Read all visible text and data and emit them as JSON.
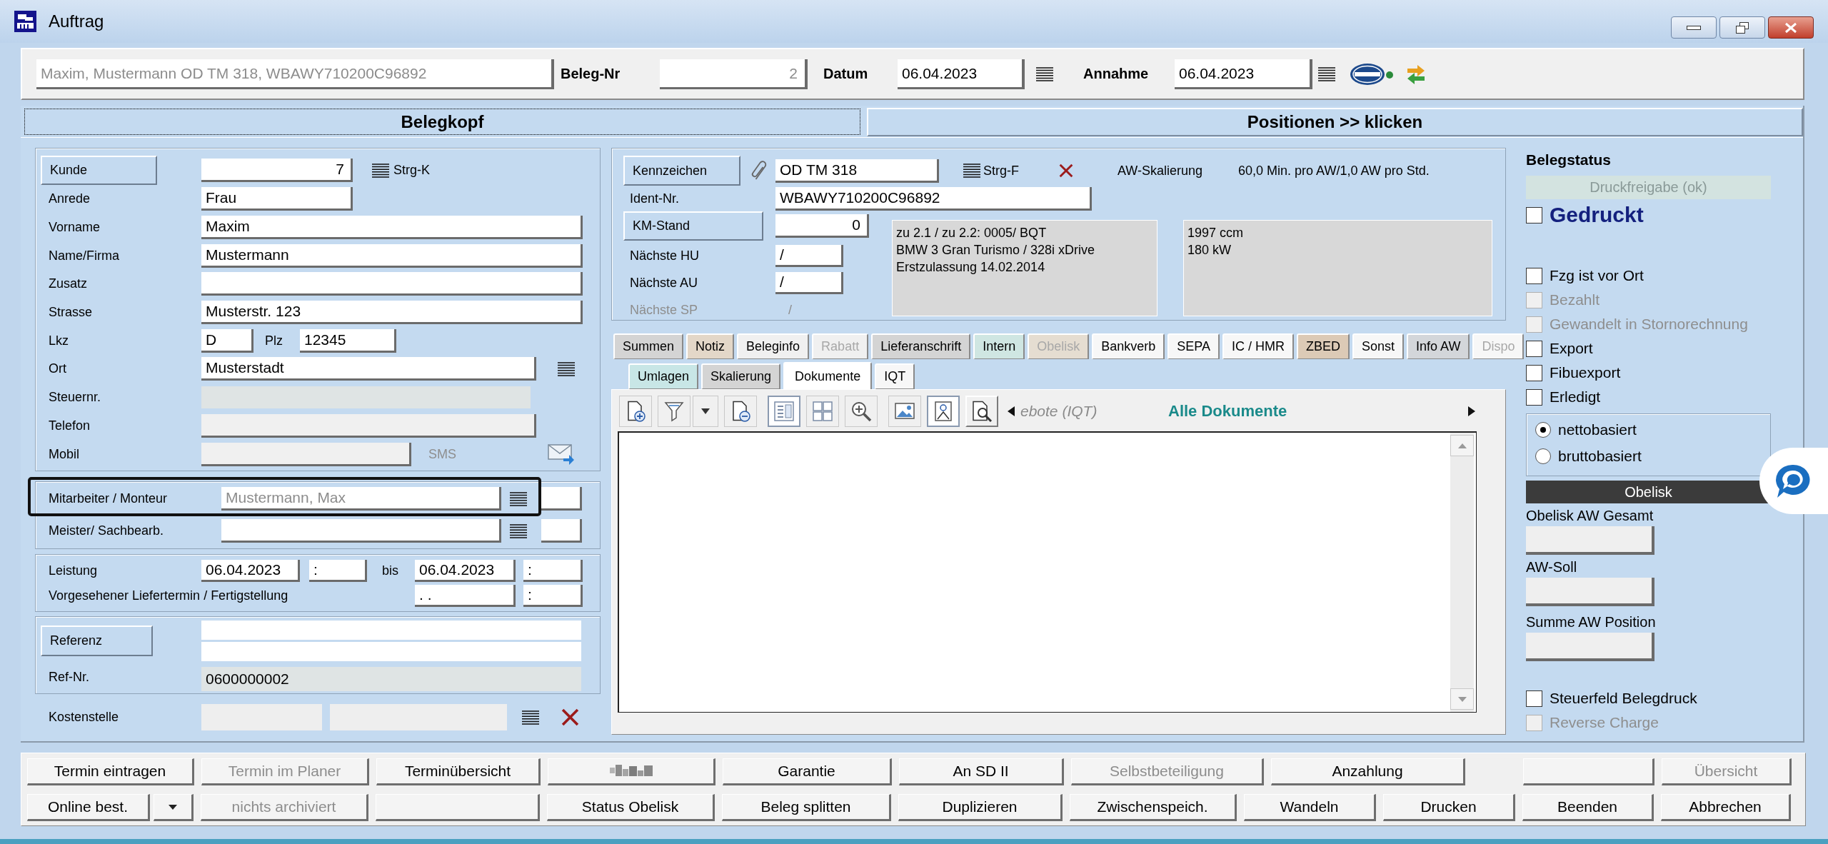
{
  "window": {
    "title": "Auftrag"
  },
  "header": {
    "summary": "Maxim, Mustermann OD TM 318, WBAWY710200C96892",
    "fields": [
      {
        "label": "Beleg-Nr",
        "value": "2",
        "kind": "number"
      },
      {
        "label": "Datum",
        "value": "06.04.2023",
        "kind": "date"
      },
      {
        "label": "Annahme",
        "value": "06.04.2023",
        "kind": "date"
      }
    ]
  },
  "page_tabs": [
    {
      "label": "Belegkopf",
      "selected": true
    },
    {
      "label": "Positionen >> klicken",
      "selected": false
    }
  ],
  "customer": {
    "rows": [
      {
        "label": "Kunde",
        "value": "7",
        "kind": "lookup",
        "hint": "Strg-K",
        "disabled": false
      },
      {
        "label": "Anrede",
        "value": "Frau",
        "kind": "short",
        "disabled": false
      },
      {
        "label": "Vorname",
        "value": "Maxim",
        "kind": "text",
        "disabled": false
      },
      {
        "label": "Name/Firma",
        "value": "Mustermann",
        "kind": "text",
        "disabled": false
      },
      {
        "label": "Zusatz",
        "kind": "text",
        "disabled": false
      },
      {
        "label": "Strasse",
        "value": "Musterstr. 123",
        "kind": "text",
        "disabled": false
      },
      {
        "label": "Lkz",
        "value": "D",
        "kind": "postal",
        "second_label": "Plz",
        "second_value": "12345",
        "disabled": false
      },
      {
        "label": "Ort",
        "value": "Musterstadt",
        "kind": "list",
        "disabled": false
      },
      {
        "label": "Steuernr.",
        "kind": "flat",
        "disabled": true
      },
      {
        "label": "Telefon",
        "kind": "wide",
        "disabled": true
      },
      {
        "label": "Mobil",
        "kind": "mobile",
        "hint": "SMS",
        "disabled": true
      }
    ]
  },
  "staff": {
    "rows": [
      {
        "label": "Mitarbeiter / Monteur",
        "value": "Mustermann, Max",
        "highlighted": true
      },
      {
        "label": "Meister/ Sachbearb.",
        "highlighted": false
      }
    ]
  },
  "service": {
    "rows": [
      {
        "label": "Leistung",
        "from_date": "06.04.2023",
        "from_time": ":",
        "to_label": "bis",
        "to_date": "06.04.2023",
        "to_time": ":"
      },
      {
        "label": "Vorgesehener Liefertermin / Fertigstellung",
        "to_date": ". .",
        "to_time": ":"
      }
    ]
  },
  "reference": {
    "button": "Referenz",
    "ref_label": "Ref-Nr.",
    "ref_value": "0600000002"
  },
  "cost_center": {
    "label": "Kostenstelle"
  },
  "vehicle": {
    "plate": {
      "label": "Kennzeichen",
      "value": "OD TM 318",
      "hint": "Strg-F"
    },
    "scaling": {
      "label": "AW-Skalierung",
      "value": "60,0 Min. pro AW/1,0 AW pro Std."
    },
    "ident": {
      "label": "Ident-Nr.",
      "value": "WBAWY710200C96892"
    },
    "rows": [
      {
        "label": "KM-Stand",
        "value": "0",
        "kind": "button",
        "disabled": false
      },
      {
        "label": "Nächste HU",
        "value": "/",
        "kind": "field",
        "disabled": false
      },
      {
        "label": "Nächste AU",
        "value": "/",
        "kind": "field",
        "disabled": false
      },
      {
        "label": "Nächste SP",
        "value": "/",
        "kind": "plain",
        "disabled": true
      }
    ],
    "info": [
      {
        "lines": [
          "zu 2.1 / zu 2.2: 0005/ BQT",
          "BMW 3 Gran Turismo / 328i xDrive",
          "Erstzulassung 14.02.2014"
        ]
      },
      {
        "lines": [
          "1997 ccm",
          "180 kW"
        ]
      }
    ]
  },
  "detail_tab_rows": [
    {
      "tabs": [
        {
          "label": "Summen",
          "color": "#d4d4d4",
          "disabled": false,
          "selected": false
        },
        {
          "label": "Notiz",
          "color": "#e3d7c8",
          "disabled": false,
          "selected": false
        },
        {
          "label": "Beleginfo",
          "color": "#f0f0f0",
          "disabled": false,
          "selected": false
        },
        {
          "label": "Rabatt",
          "color": "#f0f0f0",
          "disabled": true,
          "selected": false
        },
        {
          "label": "Lieferanschrift",
          "color": "#d4d4d4",
          "disabled": false,
          "selected": false
        },
        {
          "label": "Intern",
          "color": "#cfe6e2",
          "disabled": false,
          "selected": false
        },
        {
          "label": "Obelisk",
          "color": "#e5ddd1",
          "disabled": true,
          "selected": false
        },
        {
          "label": "Bankverb",
          "color": "#f7f7f7",
          "disabled": false,
          "selected": false
        },
        {
          "label": "SEPA",
          "color": "#f7f7f7",
          "disabled": false,
          "selected": false
        },
        {
          "label": "IC / HMR",
          "color": "#f7f7f7",
          "disabled": false,
          "selected": false
        },
        {
          "label": "ZBED",
          "color": "#dccab6",
          "disabled": false,
          "selected": false
        },
        {
          "label": "Sonst",
          "color": "#f7f7f7",
          "disabled": false,
          "selected": false
        },
        {
          "label": "Info AW",
          "color": "#d3d6da",
          "disabled": false,
          "selected": false
        },
        {
          "label": "Dispo",
          "color": "#f7f7f7",
          "disabled": true,
          "selected": false
        }
      ]
    },
    {
      "tabs": [
        {
          "label": "Umlagen",
          "color": "#c8e6e6",
          "disabled": false,
          "selected": false
        },
        {
          "label": "Skalierung",
          "color": "#d4d4d4",
          "disabled": false,
          "selected": false
        },
        {
          "label": "Dokumente",
          "color": "#ffffff",
          "disabled": false,
          "selected": true
        },
        {
          "label": "IQT",
          "color": "#f7f7f7",
          "disabled": false,
          "selected": false
        }
      ]
    }
  ],
  "documents": {
    "tools": [
      {
        "kind": "attach",
        "pressed": false
      },
      {
        "kind": "filter",
        "pressed": false
      },
      {
        "kind": "caret",
        "pressed": false
      },
      {
        "kind": "detach",
        "pressed": false
      },
      {
        "kind": "list",
        "pressed": true
      },
      {
        "kind": "grid",
        "pressed": false
      },
      {
        "kind": "zoom",
        "pressed": false
      },
      {
        "kind": "image",
        "pressed": false
      },
      {
        "kind": "portrait",
        "pressed": true
      },
      {
        "kind": "preview",
        "pressed": false
      }
    ],
    "caption": "ebote (IQT)",
    "title": "Alle Dokumente"
  },
  "status": {
    "title": "Belegstatus",
    "release": "Druckfreigabe (ok)",
    "printed": {
      "label": "Gedruckt",
      "checked": false
    },
    "checks": [
      {
        "label": "Fzg ist vor Ort",
        "checked": false,
        "disabled": false
      },
      {
        "label": "Bezahlt",
        "checked": false,
        "disabled": true
      },
      {
        "label": "Gewandelt in Stornorechnung",
        "checked": false,
        "disabled": true
      },
      {
        "label": "Export",
        "checked": false,
        "disabled": false
      },
      {
        "label": "Fibuexport",
        "checked": false,
        "disabled": false
      },
      {
        "label": "Erledigt",
        "checked": false,
        "disabled": false
      }
    ],
    "basis": [
      {
        "label": "nettobasiert",
        "selected": true
      },
      {
        "label": "bruttobasiert",
        "selected": false
      }
    ],
    "obelisk": {
      "title": "Obelisk",
      "fields": [
        {
          "label": "Obelisk AW Gesamt"
        },
        {
          "label": "AW-Soll"
        },
        {
          "label": "Summe AW Position"
        }
      ]
    },
    "options": [
      {
        "label": "Steuerfeld Belegdruck",
        "checked": false,
        "disabled": false
      },
      {
        "label": "Reverse Charge",
        "checked": false,
        "disabled": true
      }
    ]
  },
  "button_rows": [
    {
      "buttons": [
        {
          "kind": "text",
          "label": "Termin eintragen",
          "disabled": false
        },
        {
          "kind": "text",
          "label": "Termin im Planer",
          "disabled": true
        },
        {
          "kind": "text",
          "label": "Terminübersicht",
          "disabled": false
        },
        {
          "kind": "redacted"
        },
        {
          "kind": "text",
          "label": "Garantie",
          "disabled": false
        },
        {
          "kind": "text",
          "label": "An SD II",
          "disabled": false
        },
        {
          "kind": "text",
          "label": "Selbstbeteiligung",
          "disabled": true
        },
        {
          "kind": "text",
          "label": "Anzahlung",
          "disabled": false
        },
        {
          "kind": "blank"
        },
        {
          "kind": "text",
          "label": "Übersicht",
          "disabled": true
        }
      ]
    },
    {
      "buttons": [
        {
          "kind": "menu",
          "label": "Online best.",
          "disabled": false
        },
        {
          "kind": "text",
          "label": "nichts archiviert",
          "disabled": true
        },
        {
          "kind": "blank"
        },
        {
          "kind": "text",
          "label": "Status Obelisk",
          "disabled": false
        },
        {
          "kind": "text",
          "label": "Beleg splitten",
          "disabled": false
        },
        {
          "kind": "text",
          "label": "Duplizieren",
          "disabled": false
        },
        {
          "kind": "text",
          "label": "Zwischenspeich.",
          "disabled": false
        },
        {
          "kind": "text",
          "label": "Wandeln",
          "disabled": false
        },
        {
          "kind": "text",
          "label": "Drucken",
          "disabled": false
        },
        {
          "kind": "text",
          "label": "Beenden",
          "disabled": false
        },
        {
          "kind": "text",
          "label": "Abbrechen",
          "disabled": false
        }
      ]
    }
  ]
}
